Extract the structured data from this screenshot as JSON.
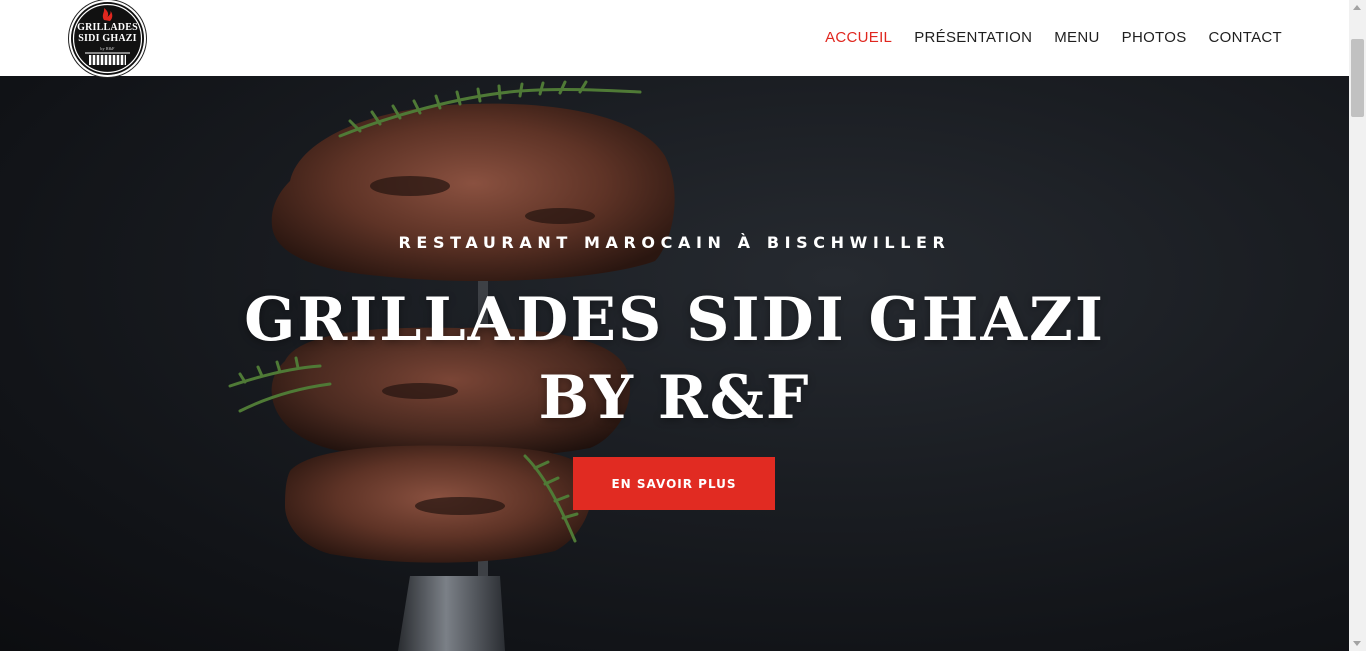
{
  "logo": {
    "line1": "GRILLADES",
    "line2": "SIDI GHAZI",
    "line3": "by R&F"
  },
  "nav": {
    "items": [
      {
        "label": "ACCUEIL",
        "active": true
      },
      {
        "label": "PRÉSENTATION",
        "active": false
      },
      {
        "label": "MENU",
        "active": false
      },
      {
        "label": "PHOTOS",
        "active": false
      },
      {
        "label": "CONTACT",
        "active": false
      }
    ]
  },
  "hero": {
    "subtitle": "RESTAURANT MAROCAIN À BISCHWILLER",
    "title_line1": "GRILLADES SIDI GHAZI",
    "title_line2": "BY R&F",
    "button_label": "EN SAVOIR PLUS"
  },
  "colors": {
    "accent": "#e0271f",
    "button": "#e12b22",
    "hero_background": "#1a1d22",
    "nav_text": "#1f1f1f"
  }
}
